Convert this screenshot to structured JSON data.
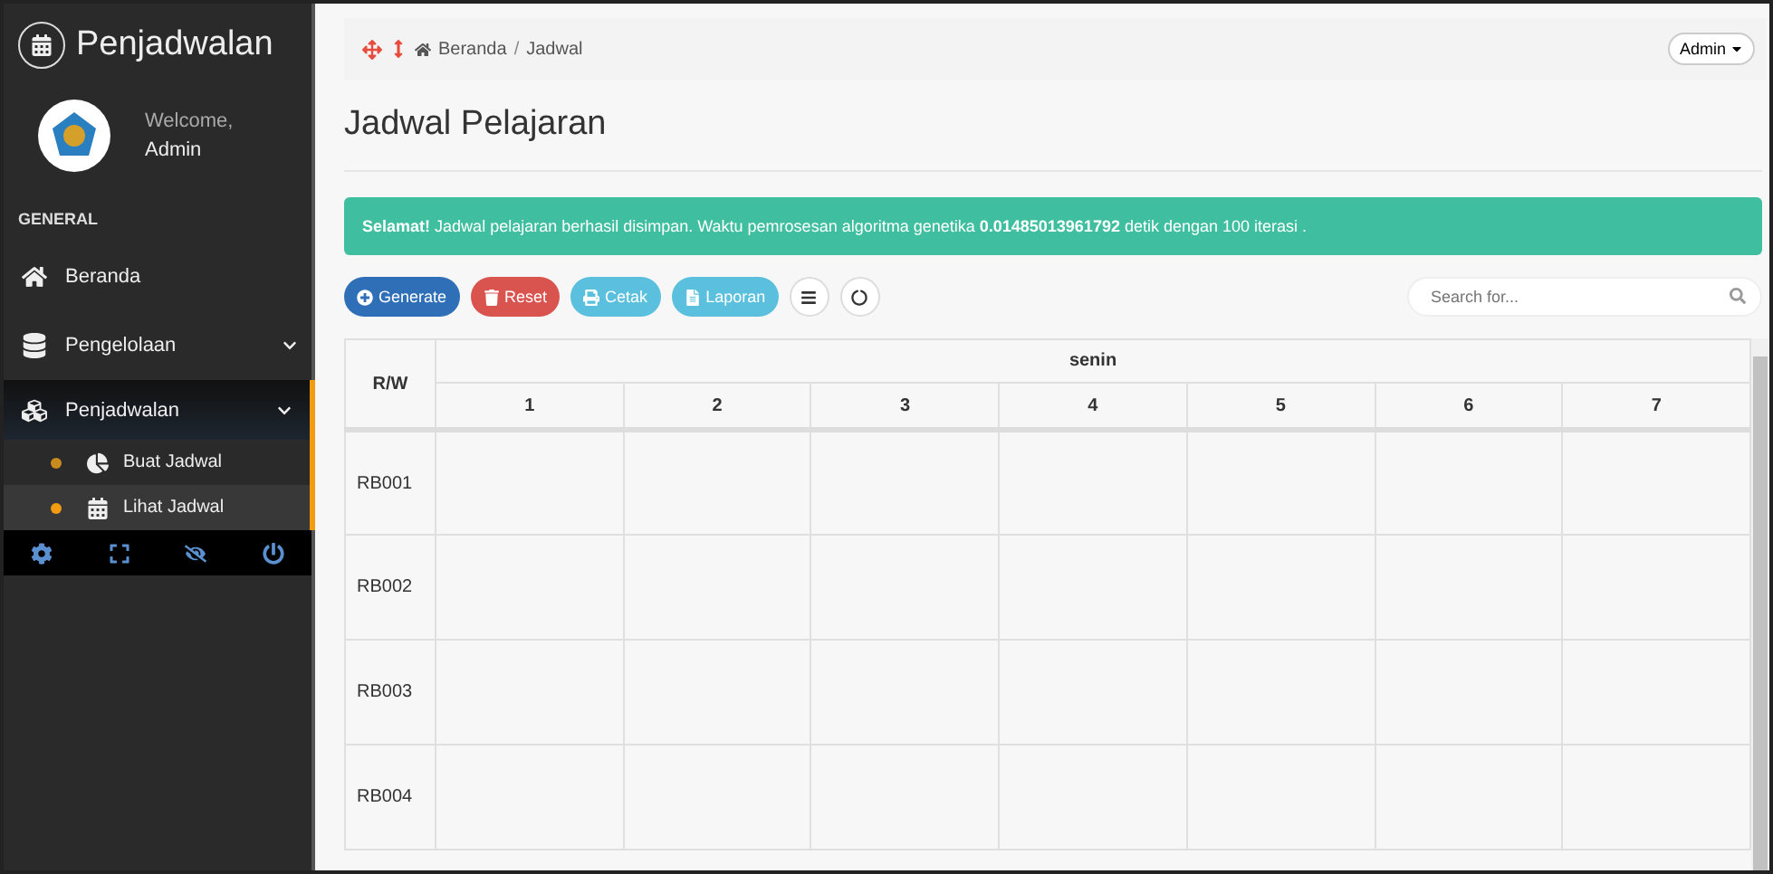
{
  "sidebar": {
    "brand": "Penjadwalan",
    "welcome": "Welcome,",
    "user": "Admin",
    "section": "GENERAL",
    "items": [
      {
        "label": "Beranda",
        "kind": "link",
        "expanded": false,
        "selected": false
      },
      {
        "label": "Pengelolaan",
        "kind": "group",
        "expanded": false,
        "selected": false
      },
      {
        "label": "Penjadwalan",
        "kind": "group",
        "expanded": true,
        "selected": true,
        "children": [
          {
            "label": "Buat Jadwal",
            "selected": false
          },
          {
            "label": "Lihat Jadwal",
            "selected": true
          }
        ]
      }
    ]
  },
  "topbar": {
    "breadcrumb": [
      "Beranda",
      "Jadwal"
    ],
    "separator": "/",
    "user_menu": "Admin"
  },
  "page_title": "Jadwal Pelajaran",
  "alert": {
    "strong": "Selamat!",
    "message": "Jadwal pelajaran berhasil disimpan. Waktu pemrosesan algoritma genetika **0.01485013961792** detik dengan 100 iterasi ."
  },
  "toolbar": {
    "buttons": [
      {
        "label": "Generate",
        "kind": "primary"
      },
      {
        "label": "Reset",
        "kind": "danger"
      },
      {
        "label": "Cetak",
        "kind": "info"
      },
      {
        "label": "Laporan",
        "kind": "info"
      },
      {
        "kind": "round"
      },
      {
        "kind": "round"
      }
    ],
    "search": {
      "placeholder": "Search for..."
    }
  },
  "table": {
    "corner": "R/W",
    "day": "senin",
    "columns": [
      "1",
      "2",
      "3",
      "4",
      "5",
      "6",
      "7"
    ],
    "rows": [
      "RB001",
      "RB002",
      "RB003",
      "RB004"
    ]
  }
}
